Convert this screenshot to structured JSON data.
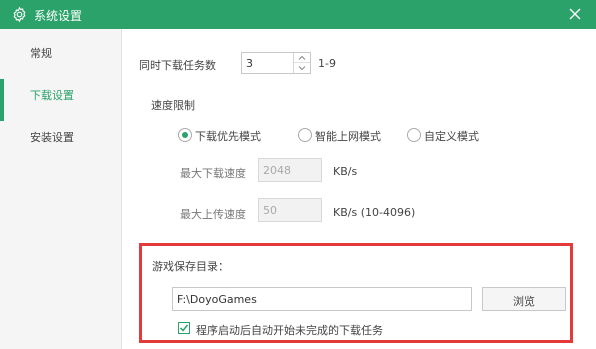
{
  "window": {
    "title": "系统设置",
    "accent_color": "#2aa26a",
    "highlight_color": "#e53a3a"
  },
  "sidebar": {
    "items": [
      {
        "label": "常规",
        "active": false
      },
      {
        "label": "下载设置",
        "active": true
      },
      {
        "label": "安装设置",
        "active": false
      }
    ]
  },
  "download": {
    "concurrent_label": "同时下载任务数",
    "concurrent_value": "3",
    "concurrent_range": "1-9",
    "speed_limit_label": "速度限制",
    "modes": [
      {
        "label": "下载优先模式",
        "selected": true
      },
      {
        "label": "智能上网模式",
        "selected": false
      },
      {
        "label": "自定义模式",
        "selected": false
      }
    ],
    "max_download_label": "最大下载速度",
    "max_download_value": "2048",
    "max_download_unit": "KB/s",
    "max_upload_label": "最大上传速度",
    "max_upload_value": "50",
    "max_upload_unit": "KB/s (10-4096)"
  },
  "save_dir": {
    "label": "游戏保存目录：",
    "path": "F:\\DoyoGames",
    "browse_label": "浏览",
    "autostart_label": "程序启动后自动开始未完成的下载任务",
    "autostart_checked": true
  }
}
